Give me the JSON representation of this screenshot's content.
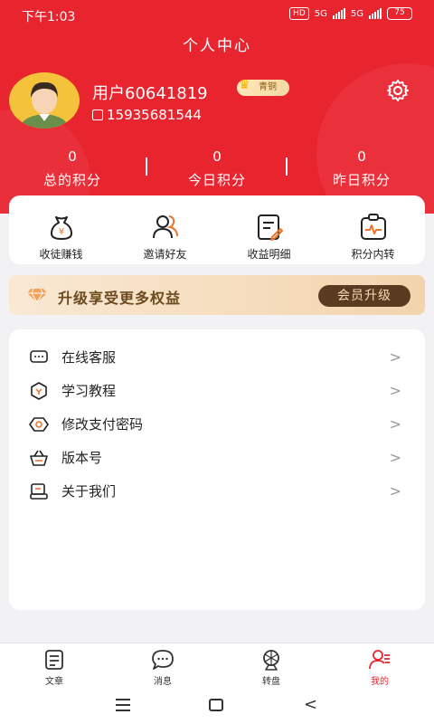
{
  "status": {
    "time": "下午1:03",
    "net1": "5G",
    "net2": "5G",
    "hd": "HD",
    "battery": "75"
  },
  "header": {
    "title": "个人中心"
  },
  "user": {
    "name": "用户60641819",
    "level": "青铜",
    "phone": "15935681544"
  },
  "stats": [
    {
      "value": "0",
      "label": "总的积分"
    },
    {
      "value": "0",
      "label": "今日积分"
    },
    {
      "value": "0",
      "label": "昨日积分"
    }
  ],
  "actions": [
    {
      "label": "收徒赚钱",
      "icon": "money-bag-icon"
    },
    {
      "label": "邀请好友",
      "icon": "invite-friends-icon"
    },
    {
      "label": "收益明细",
      "icon": "earnings-detail-icon"
    },
    {
      "label": "积分内转",
      "icon": "points-transfer-icon"
    }
  ],
  "vip": {
    "text": "升级享受更多权益",
    "button": "会员升级"
  },
  "menu": [
    {
      "label": "在线客服",
      "icon": "chat-icon"
    },
    {
      "label": "学习教程",
      "icon": "tutorial-icon"
    },
    {
      "label": "修改支付密码",
      "icon": "password-icon"
    },
    {
      "label": "版本号",
      "icon": "basket-icon"
    },
    {
      "label": "关于我们",
      "icon": "about-icon"
    }
  ],
  "tabs": [
    {
      "label": "文章",
      "icon": "article-icon"
    },
    {
      "label": "消息",
      "icon": "message-icon"
    },
    {
      "label": "转盘",
      "icon": "wheel-icon"
    },
    {
      "label": "我的",
      "icon": "profile-icon"
    }
  ],
  "colors": {
    "primary": "#e8242f",
    "vip_dark": "#5a3b22",
    "vip_light": "#f6dcb1"
  }
}
